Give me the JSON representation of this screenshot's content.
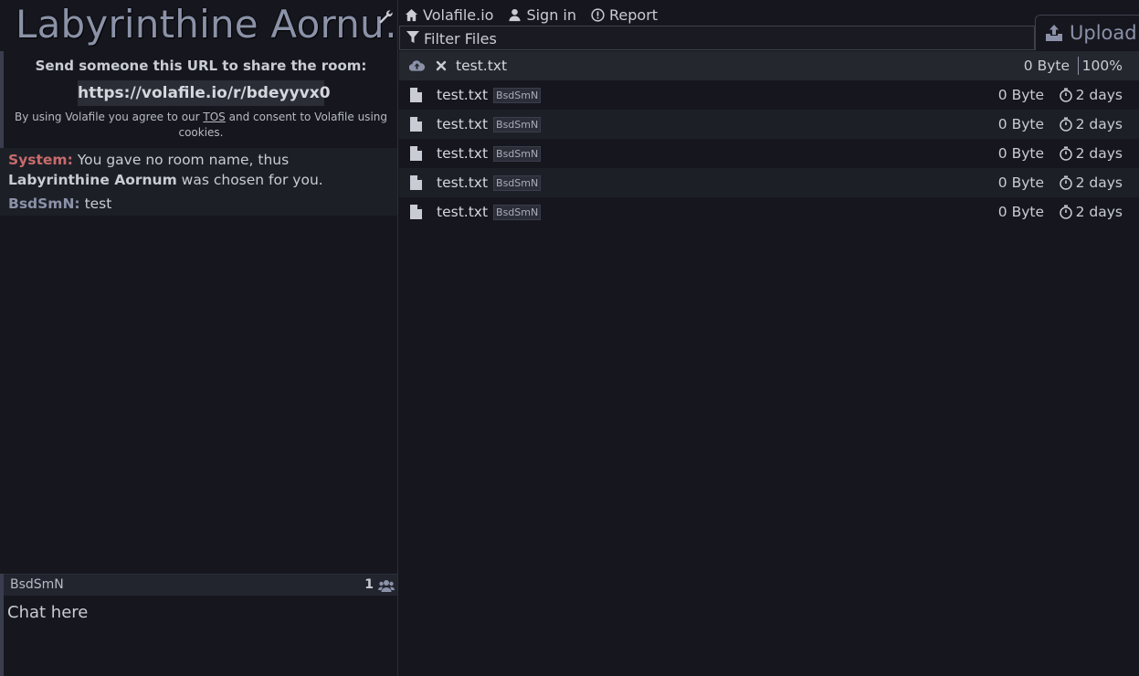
{
  "room": {
    "title": "Labyrinthine Aornu…"
  },
  "nav": {
    "home_label": "Volafile.io",
    "signin_label": "Sign in",
    "report_label": "Report"
  },
  "share": {
    "heading": "Send someone this URL to share the room:",
    "url": "https://volafile.io/r/bdeyyvx0",
    "tos_prefix": "By using Volafile you agree to our ",
    "tos_link": "TOS",
    "tos_suffix": " and consent to Volafile using cookies."
  },
  "chat": {
    "messages": [
      {
        "nick": "System:",
        "text_before": "You gave no room name, thus ",
        "highlight": "Labyrinthine Aornum",
        "text_after": " was chosen for you."
      },
      {
        "nick": "BsdSmN:",
        "text": "test"
      }
    ],
    "username": "BsdSmN",
    "user_count": "1",
    "input_placeholder": "Chat here"
  },
  "filter": {
    "placeholder": "Filter Files"
  },
  "upload": {
    "label": "Upload"
  },
  "uploading": {
    "name": "test.txt",
    "size": "0 Byte",
    "progress": "100%"
  },
  "files": [
    {
      "name": "test.txt",
      "tag": "BsdSmN",
      "size": "0 Byte",
      "expiry": "2 days"
    },
    {
      "name": "test.txt",
      "tag": "BsdSmN",
      "size": "0 Byte",
      "expiry": "2 days"
    },
    {
      "name": "test.txt",
      "tag": "BsdSmN",
      "size": "0 Byte",
      "expiry": "2 days"
    },
    {
      "name": "test.txt",
      "tag": "BsdSmN",
      "size": "0 Byte",
      "expiry": "2 days"
    },
    {
      "name": "test.txt",
      "tag": "BsdSmN",
      "size": "0 Byte",
      "expiry": "2 days"
    }
  ],
  "colors": {
    "background": "#16171e",
    "system_nick": "#c86b6b",
    "user_nick": "#8b92a8",
    "accent": "#8b92a8"
  },
  "icons": [
    "wrench-icon",
    "home-icon",
    "user-icon",
    "report-icon",
    "filter-icon",
    "upload-icon",
    "cloud-upload-icon",
    "close-icon",
    "file-icon",
    "timer-icon",
    "users-icon"
  ]
}
